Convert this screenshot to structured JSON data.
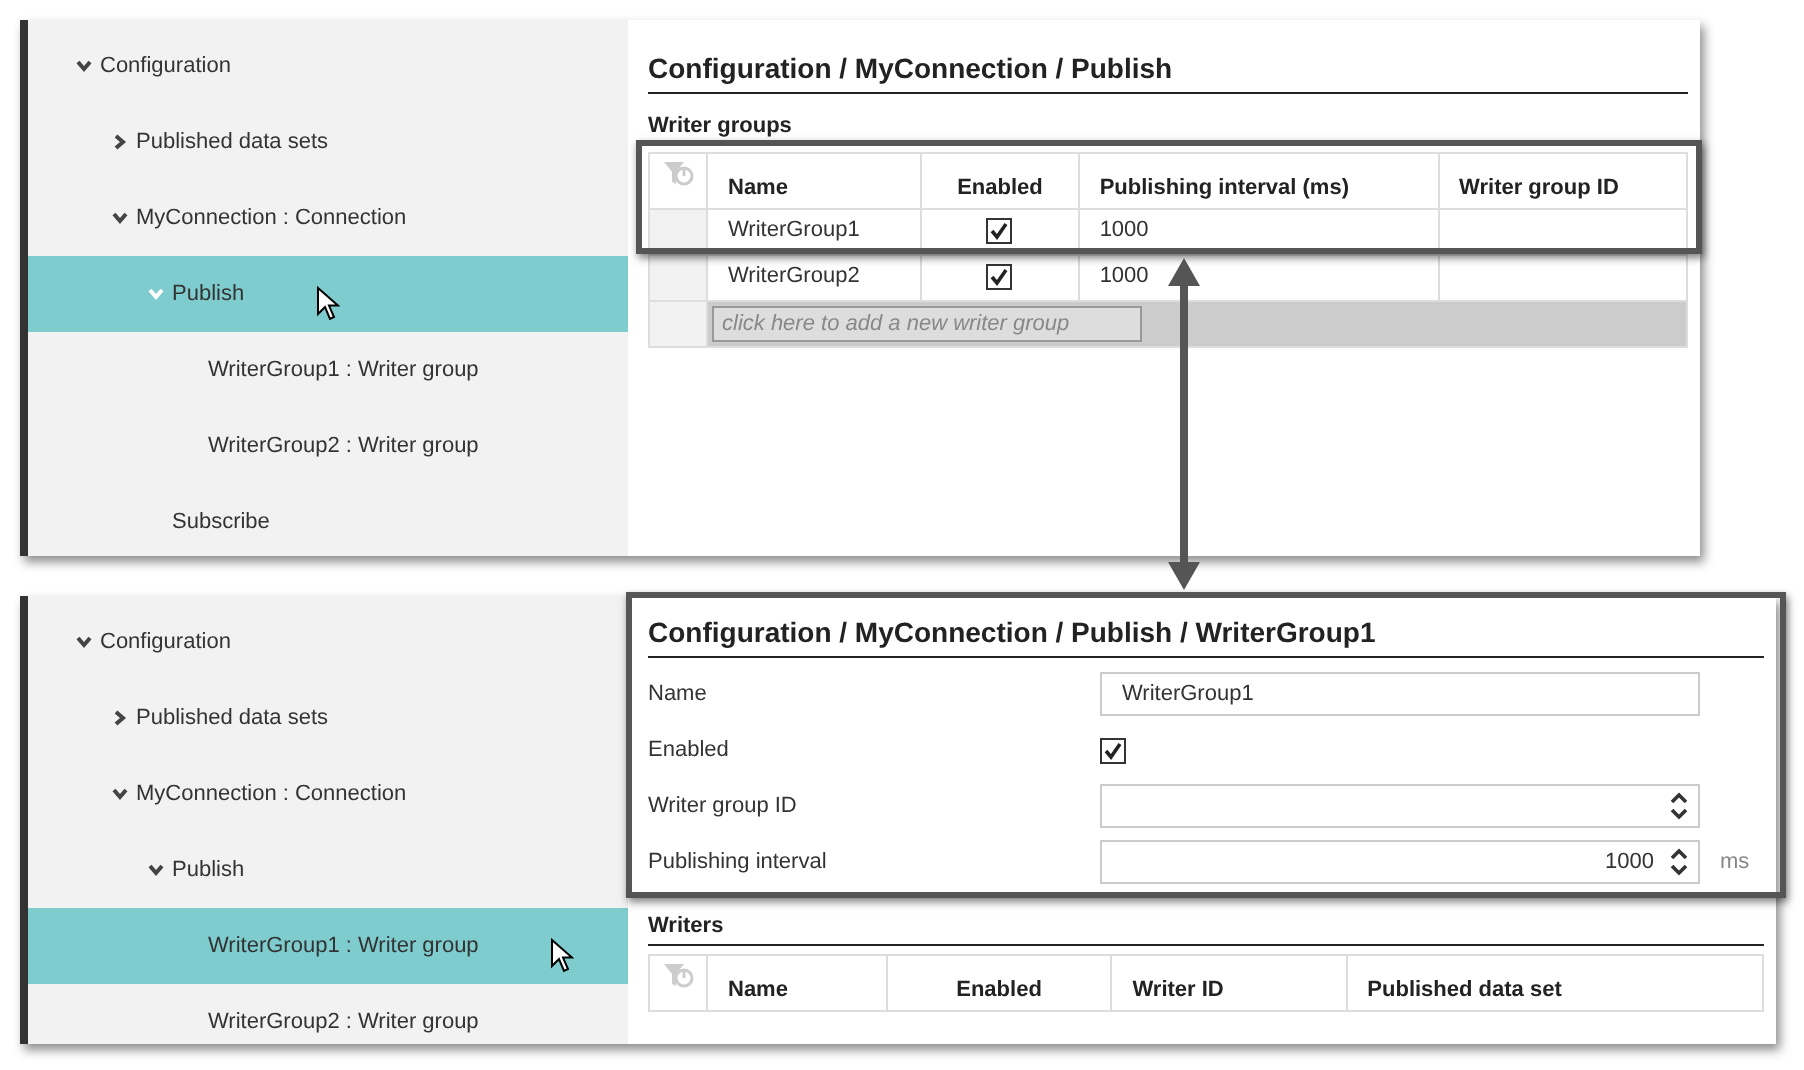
{
  "panels": [
    {
      "tree": [
        {
          "label": "Configuration",
          "expanded": true,
          "selected": false,
          "children": [
            {
              "label": "Published data sets",
              "expanded": false,
              "selected": false
            },
            {
              "label": "MyConnection : Connection",
              "expanded": true,
              "selected": false,
              "children": [
                {
                  "label": "Publish",
                  "expanded": true,
                  "selected": true,
                  "cursor": true,
                  "children": [
                    {
                      "label": "WriterGroup1 : Writer group",
                      "selected": false
                    },
                    {
                      "label": "WriterGroup2 : Writer group",
                      "selected": false
                    }
                  ]
                },
                {
                  "label": "Subscribe",
                  "selected": false
                }
              ]
            }
          ]
        }
      ],
      "content": {
        "kind": "table_view",
        "breadcrumb": "Configuration / MyConnection / Publish",
        "section": "Writer groups",
        "table": {
          "columns": [
            "Name",
            "Enabled",
            "Publishing interval (ms)",
            "Writer group ID"
          ],
          "rows": [
            {
              "name": "WriterGroup1",
              "enabled": true,
              "interval": "1000",
              "highlighted": true
            },
            {
              "name": "WriterGroup2",
              "enabled": true,
              "interval": "1000",
              "highlighted": false
            }
          ],
          "new_row_placeholder": "click here to add a new writer group"
        }
      }
    },
    {
      "tree": [
        {
          "label": "Configuration",
          "expanded": true,
          "selected": false,
          "children": [
            {
              "label": "Published data sets",
              "expanded": false,
              "selected": false
            },
            {
              "label": "MyConnection : Connection",
              "expanded": true,
              "selected": false,
              "children": [
                {
                  "label": "Publish",
                  "expanded": true,
                  "selected": false,
                  "children": [
                    {
                      "label": "WriterGroup1 : Writer group",
                      "selected": true,
                      "cursor": true
                    },
                    {
                      "label": "WriterGroup2 : Writer group",
                      "selected": false
                    }
                  ]
                }
              ]
            }
          ]
        }
      ],
      "content": {
        "kind": "form_view",
        "breadcrumb": "Configuration / MyConnection / Publish / WriterGroup1",
        "highlighted": true,
        "fields": [
          {
            "kind": "text",
            "label": "Name",
            "value": "WriterGroup1"
          },
          {
            "kind": "checkbox",
            "label": "Enabled",
            "checked": true
          },
          {
            "kind": "spin",
            "label": "Writer group ID"
          },
          {
            "kind": "spin",
            "label": "Publishing interval",
            "value": "1000",
            "unit": "ms"
          }
        ],
        "section": "Writers",
        "table": {
          "columns": [
            "Name",
            "Enabled",
            "Writer ID",
            "Published data set"
          ]
        }
      }
    }
  ]
}
